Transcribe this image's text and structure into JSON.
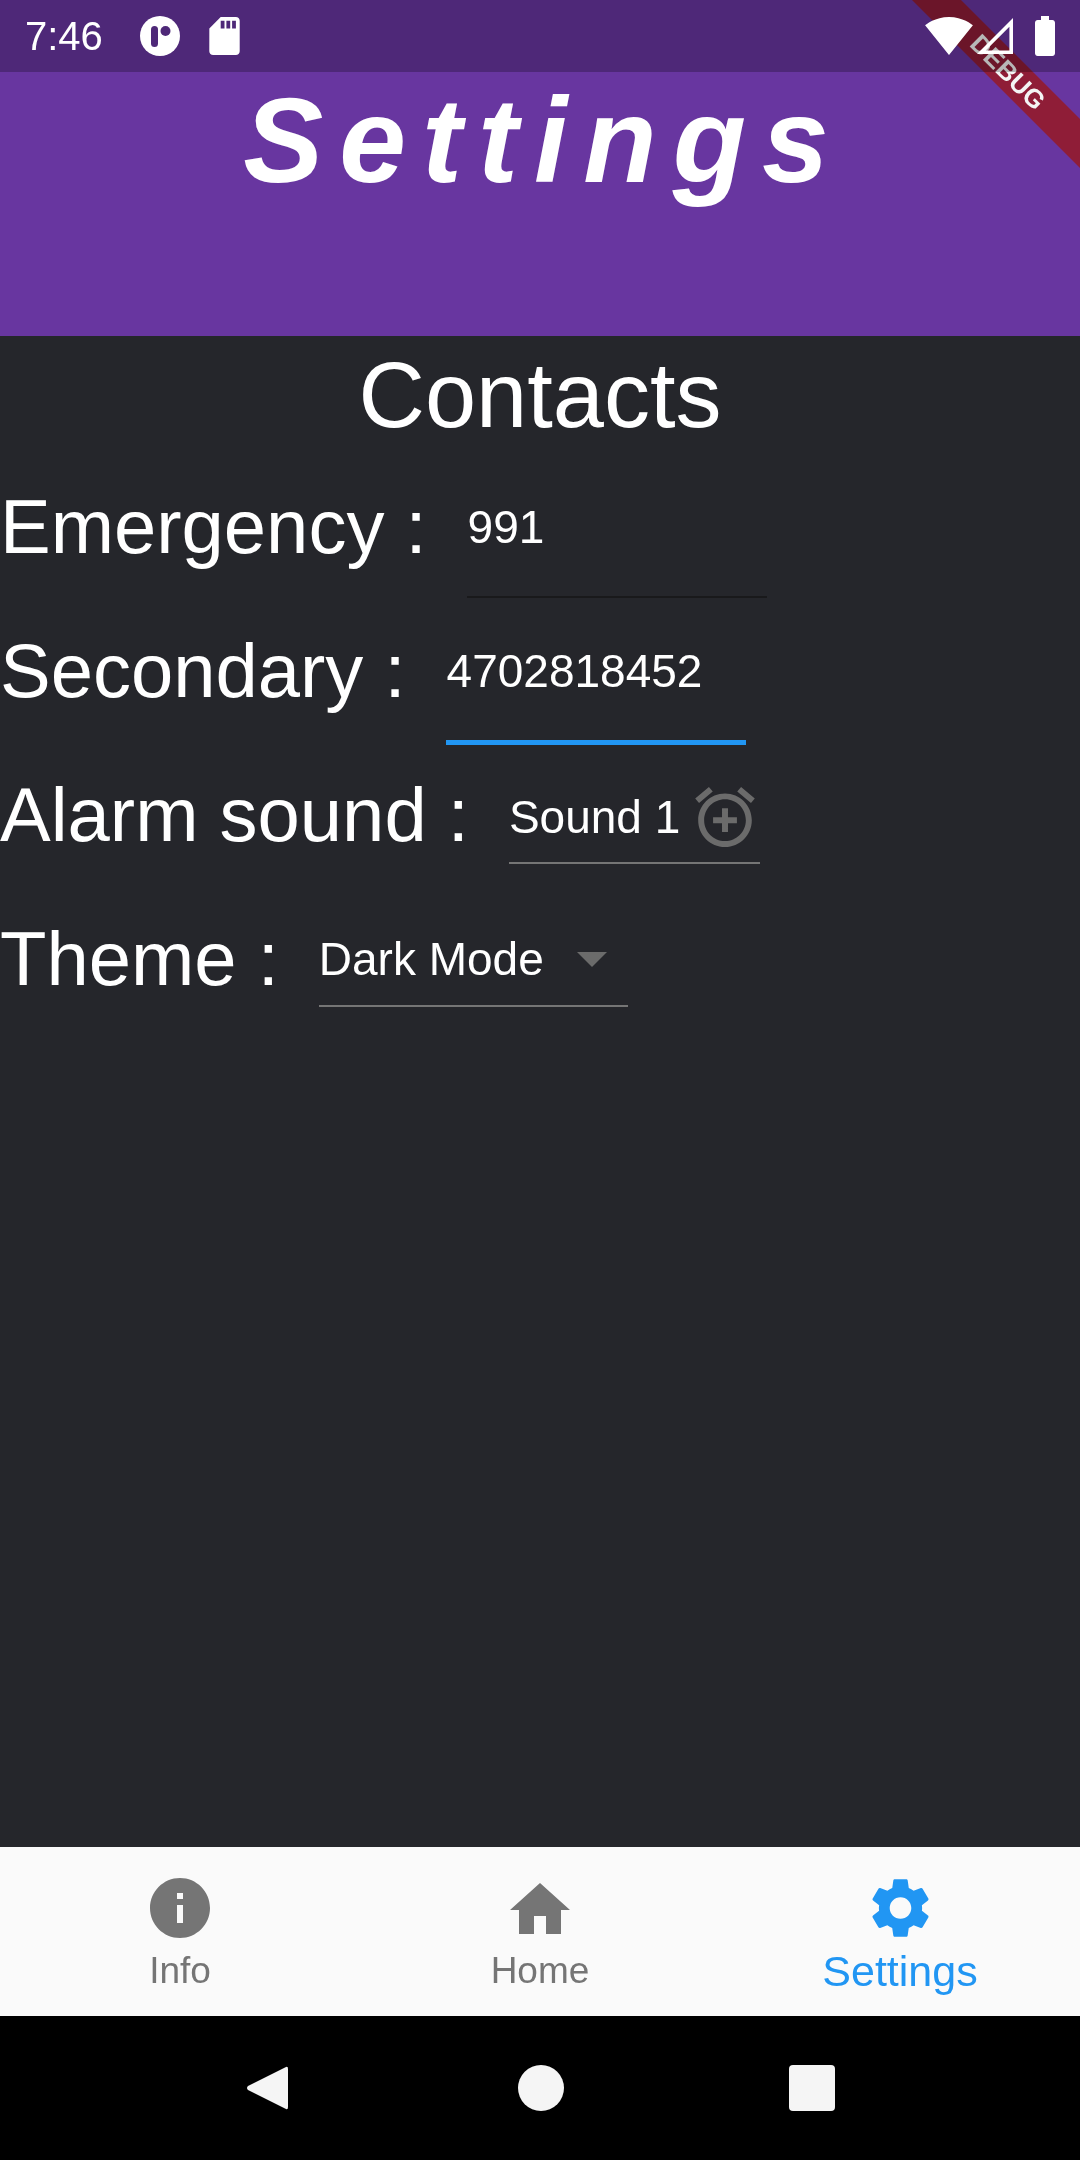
{
  "status_bar": {
    "time": "7:46"
  },
  "debug_banner": {
    "label": "DEBUG"
  },
  "app_bar": {
    "title": "Settings"
  },
  "section": {
    "heading": "Contacts"
  },
  "fields": [
    {
      "kind": "text",
      "label": "Emergency :",
      "value": "991",
      "focused": false
    },
    {
      "kind": "text",
      "label": "Secondary :",
      "value": "4702818452",
      "focused": true
    },
    {
      "kind": "picker",
      "label": "Alarm sound :",
      "value": "Sound 1",
      "focused": false
    },
    {
      "kind": "dropdown",
      "label": "Theme :",
      "value": "Dark Mode",
      "focused": false
    }
  ],
  "bottom_nav": {
    "items": [
      {
        "label": "Info",
        "selected": false
      },
      {
        "label": "Home",
        "selected": false
      },
      {
        "label": "Settings",
        "selected": true
      }
    ]
  }
}
